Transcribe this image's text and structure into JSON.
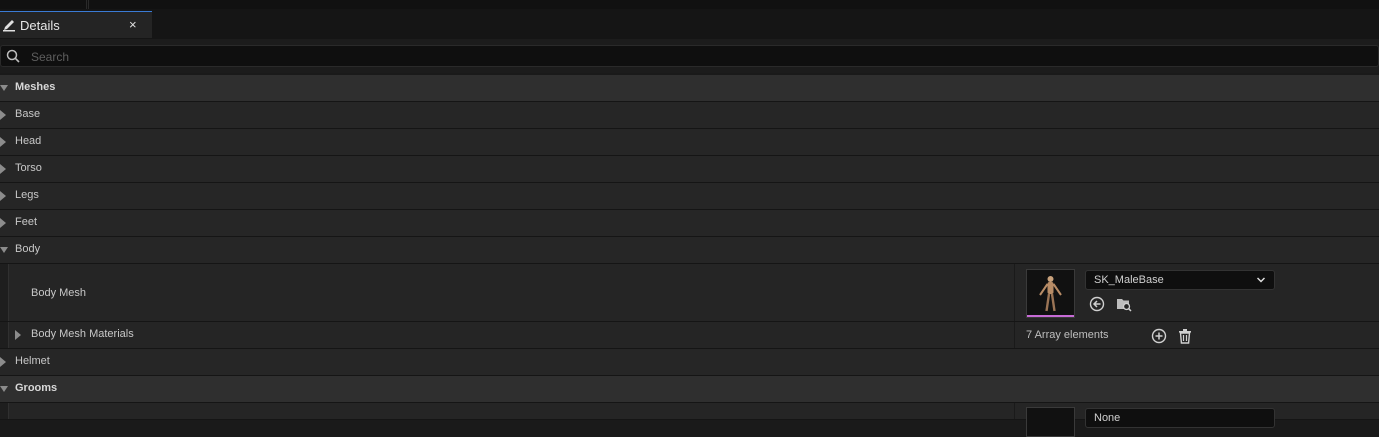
{
  "tab": {
    "title": "Details",
    "close": "×"
  },
  "search": {
    "placeholder": "Search"
  },
  "sections": {
    "meshes": "Meshes",
    "base": "Base",
    "head": "Head",
    "torso": "Torso",
    "legs": "Legs",
    "feet": "Feet",
    "body": "Body",
    "helmet": "Helmet",
    "grooms": "Grooms"
  },
  "body": {
    "mesh_label": "Body Mesh",
    "mesh_value": "SK_MaleBase",
    "materials_label": "Body Mesh Materials",
    "materials_count": "7 Array elements"
  },
  "grooms": {
    "first_value": "None"
  },
  "colors": {
    "accent": "#3a7bd5",
    "thumb_bar": "#c76bd6"
  }
}
